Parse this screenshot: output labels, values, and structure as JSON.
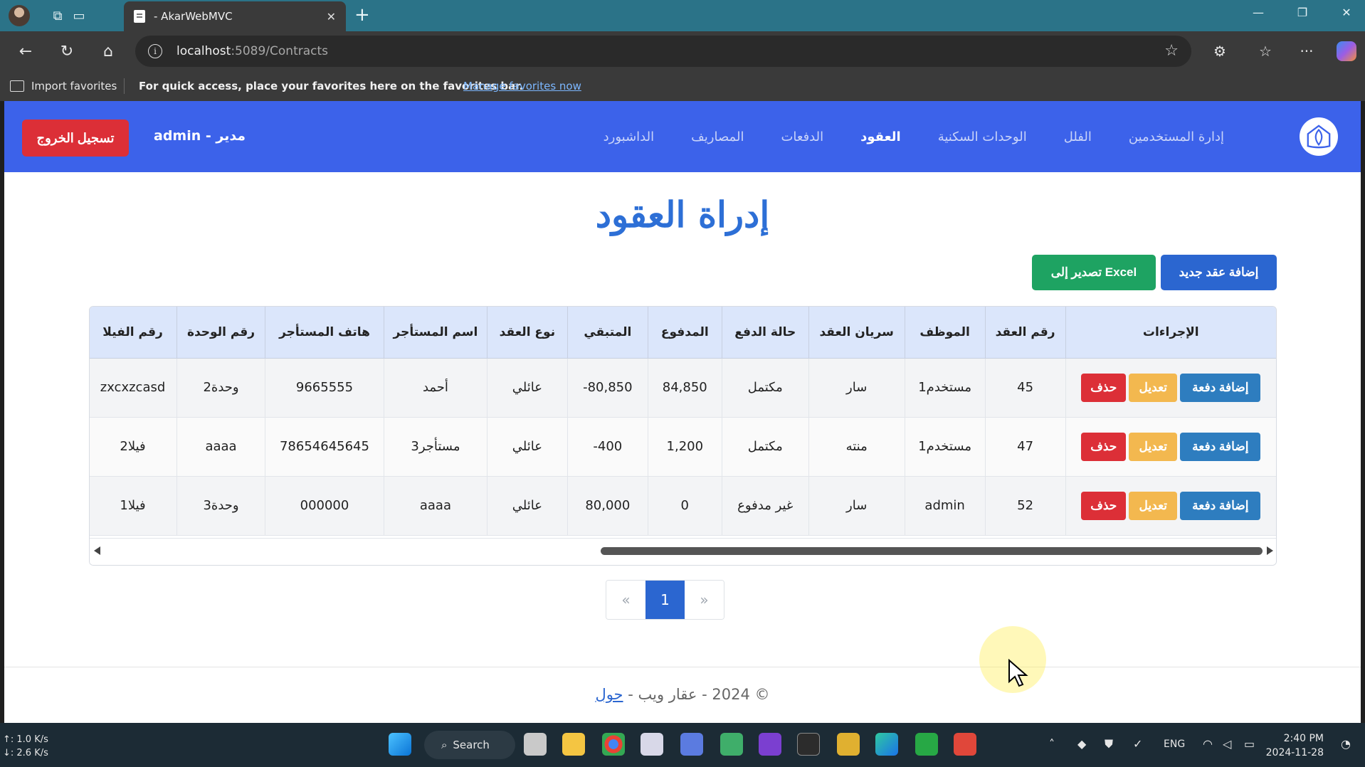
{
  "browser": {
    "tab_title": "- AkarWebMVC",
    "url_host": "localhost",
    "url_path": ":5089/Contracts",
    "favbar": {
      "import_label": "Import favorites",
      "message": "For quick access, place your favorites here on the favorites bar.",
      "manage_link": "Manage favorites now"
    }
  },
  "navbar": {
    "links": [
      {
        "label": "إدارة المستخدمين",
        "active": false
      },
      {
        "label": "الفلل",
        "active": false
      },
      {
        "label": "الوحدات السكنية",
        "active": false
      },
      {
        "label": "العقود",
        "active": true
      },
      {
        "label": "الدفعات",
        "active": false
      },
      {
        "label": "المصاريف",
        "active": false
      },
      {
        "label": "الداشبورد",
        "active": false
      }
    ],
    "user_label": "admin - مدير",
    "logout_label": "تسجيل الخروج"
  },
  "page": {
    "title": "إدراة العقود",
    "add_contract_label": "إضافة عقد جديد",
    "export_label": "تصدير إلى Excel"
  },
  "table": {
    "headers": {
      "actions": "الإجراءات",
      "contract_no": "رقم العقد",
      "employee": "الموظف",
      "validity": "سريان العقد",
      "payment_status": "حالة الدفع",
      "paid": "المدفوع",
      "remaining": "المتبقي",
      "contract_type": "نوع العقد",
      "tenant_name": "اسم المستأجر",
      "tenant_phone": "هاتف المستأجر",
      "unit_no": "رقم الوحدة",
      "villa_no": "رقم الفيلا"
    },
    "action_labels": {
      "add_payment": "إضافة دفعة",
      "edit": "تعديل",
      "delete": "حذف"
    },
    "rows": [
      {
        "contract_no": "45",
        "employee": "مستخدم1",
        "validity": "سار",
        "payment_status": "مكتمل",
        "paid": "84,850",
        "remaining": "-80,850",
        "contract_type": "عائلي",
        "tenant_name": "أحمد",
        "tenant_phone": "9665555",
        "unit_no": "وحدة2",
        "villa_no": "zxcxzcasd"
      },
      {
        "contract_no": "47",
        "employee": "مستخدم1",
        "validity": "منته",
        "payment_status": "مكتمل",
        "paid": "1,200",
        "remaining": "-400",
        "contract_type": "عائلي",
        "tenant_name": "مستأجر3",
        "tenant_phone": "78654645645",
        "unit_no": "aaaa",
        "villa_no": "فيلا2"
      },
      {
        "contract_no": "52",
        "employee": "admin",
        "validity": "سار",
        "payment_status": "غير مدفوع",
        "paid": "0",
        "remaining": "80,000",
        "contract_type": "عائلي",
        "tenant_name": "aaaa",
        "tenant_phone": "000000",
        "unit_no": "وحدة3",
        "villa_no": "فيلا1"
      }
    ]
  },
  "pagination": {
    "prev": "«",
    "current": "1",
    "next": "»"
  },
  "footer": {
    "text": "© 2024 - عقار ويب - ",
    "link": "حول"
  },
  "taskbar": {
    "net_up": "↑: 1.0 K/s",
    "net_down": "↓: 2.6 K/s",
    "search_label": "Search",
    "language": "ENG",
    "time": "2:40 PM",
    "date": "2024-11-28"
  }
}
